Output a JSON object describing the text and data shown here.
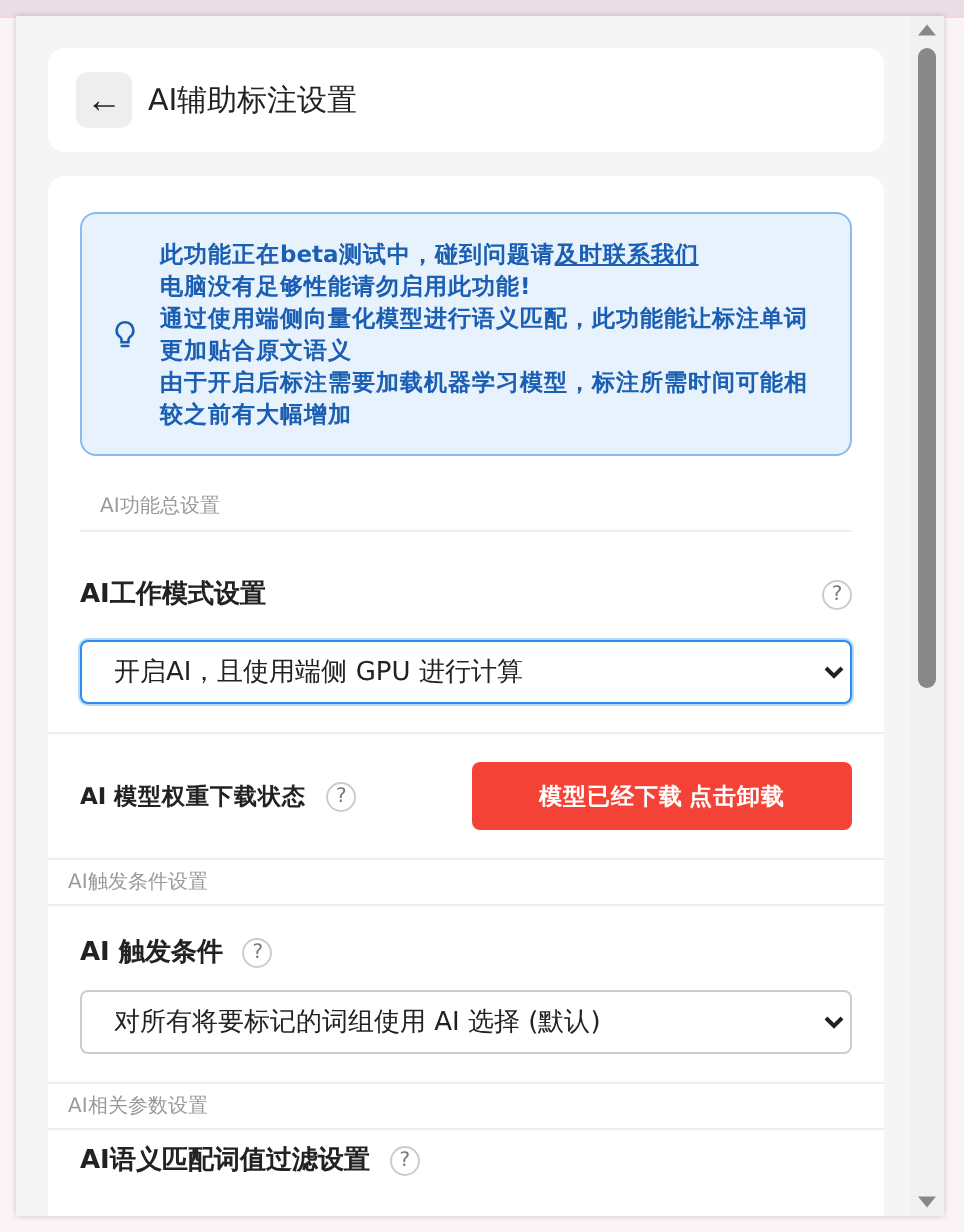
{
  "header": {
    "back": "←",
    "title": "AI辅助标注设置"
  },
  "notice": {
    "lines": [
      {
        "text": "此功能正在beta测试中，碰到问题请",
        "link": "及时联系我们"
      },
      {
        "text": "电脑没有足够性能请勿启用此功能!"
      },
      {
        "text": "通过使用端侧向量化模型进行语义匹配，此功能能让标注单词更加贴合原文语义"
      },
      {
        "text": "由于开启后标注需要加载机器学习模型，标注所需时间可能相较之前有大幅增加"
      }
    ]
  },
  "sections": [
    {
      "heading": "AI功能总设置",
      "items": [
        {
          "kind": "select",
          "label": "AI工作模式设置",
          "help": "?",
          "help_right": true,
          "value": "开启AI，且使用端侧 GPU 进行计算",
          "focused": true
        },
        {
          "kind": "button",
          "label": "AI 模型权重下载状态",
          "help": "?",
          "button": "模型已经下载 点击卸载"
        }
      ]
    },
    {
      "heading": "AI触发条件设置",
      "items": [
        {
          "kind": "select",
          "label": "AI 触发条件",
          "help": "?",
          "help_right": false,
          "value": "对所有将要标记的词组使用 AI 选择 (默认)",
          "focused": false
        }
      ]
    },
    {
      "heading": "AI相关参数设置",
      "items": [
        {
          "kind": "label",
          "label": "AI语义匹配词值过滤设置",
          "help": "?"
        }
      ]
    }
  ]
}
